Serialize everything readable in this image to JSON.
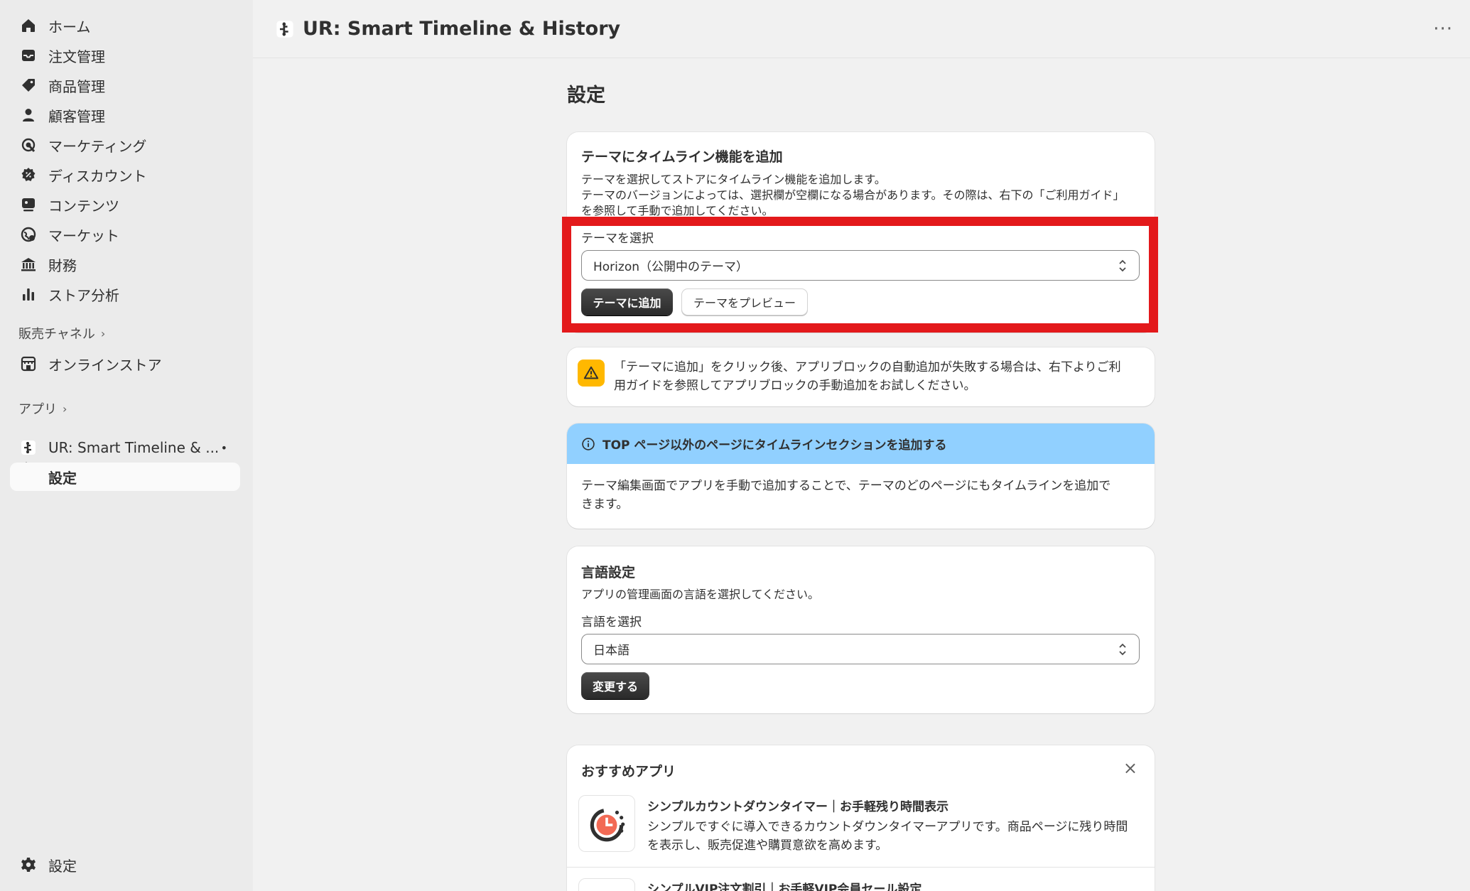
{
  "sidebar": {
    "items": [
      {
        "label": "ホーム",
        "icon": "home-icon"
      },
      {
        "label": "注文管理",
        "icon": "inbox-icon"
      },
      {
        "label": "商品管理",
        "icon": "tag-icon"
      },
      {
        "label": "顧客管理",
        "icon": "person-icon"
      },
      {
        "label": "マーケティング",
        "icon": "target-icon"
      },
      {
        "label": "ディスカウント",
        "icon": "discount-icon"
      },
      {
        "label": "コンテンツ",
        "icon": "content-icon"
      },
      {
        "label": "マーケット",
        "icon": "globe-icon"
      },
      {
        "label": "財務",
        "icon": "bank-icon"
      },
      {
        "label": "ストア分析",
        "icon": "bar-chart-icon"
      }
    ],
    "sales_channels_label": "販売チャネル",
    "online_store_label": "オンラインストア",
    "apps_label": "アプリ",
    "app_name": "UR: Smart Timeline & ...",
    "app_sub_settings": "設定",
    "settings_label": "設定"
  },
  "topbar": {
    "title": "UR: Smart Timeline & History",
    "more": "···"
  },
  "page": {
    "title": "設定"
  },
  "theme_card": {
    "title": "テーマにタイムライン機能を追加",
    "desc_line1": "テーマを選択してストアにタイムライン機能を追加します。",
    "desc_line2": "テーマのバージョンによっては、選択欄が空欄になる場合があります。その際は、右下の「ご利用ガイド」",
    "desc_line3": "を参照して手動で追加してください。",
    "select_label": "テーマを選択",
    "selected_theme": "Horizon（公開中のテーマ）",
    "add_button": "テーマに追加",
    "preview_button": "テーマをプレビュー"
  },
  "warning_card": {
    "line1": "「テーマに追加」をクリック後、アプリブロックの自動追加が失敗する場合は、右下よりご利",
    "line2": "用ガイドを参照してアプリブロックの手動追加をお試しください。"
  },
  "info_card": {
    "title": "TOP ページ以外のページにタイムラインセクションを追加する",
    "line1": "テーマ編集画面でアプリを手動で追加することで、テーマのどのページにもタイムラインを追加で",
    "line2": "きます。"
  },
  "language_card": {
    "title": "言語設定",
    "desc": "アプリの管理画面の言語を選択してください。",
    "select_label": "言語を選択",
    "selected_language": "日本語",
    "change_button": "変更する"
  },
  "recommended_card": {
    "title": "おすすめアプリ",
    "close": "×",
    "items": [
      {
        "name": "シンプルカウントダウンタイマー｜お手軽残り時間表示",
        "desc_line1": "シンプルですぐに導入できるカウントダウンタイマーアプリです。商品ページに残り時間",
        "desc_line2": "を表示し、販売促進や購買意欲を高めます。"
      },
      {
        "name": "シンプルVIP注文割引｜お手軽VIP会員セール設定"
      }
    ]
  },
  "colors": {
    "highlight": "#e3191b",
    "info_banner": "#91d0ff",
    "warning": "#ffb800"
  }
}
